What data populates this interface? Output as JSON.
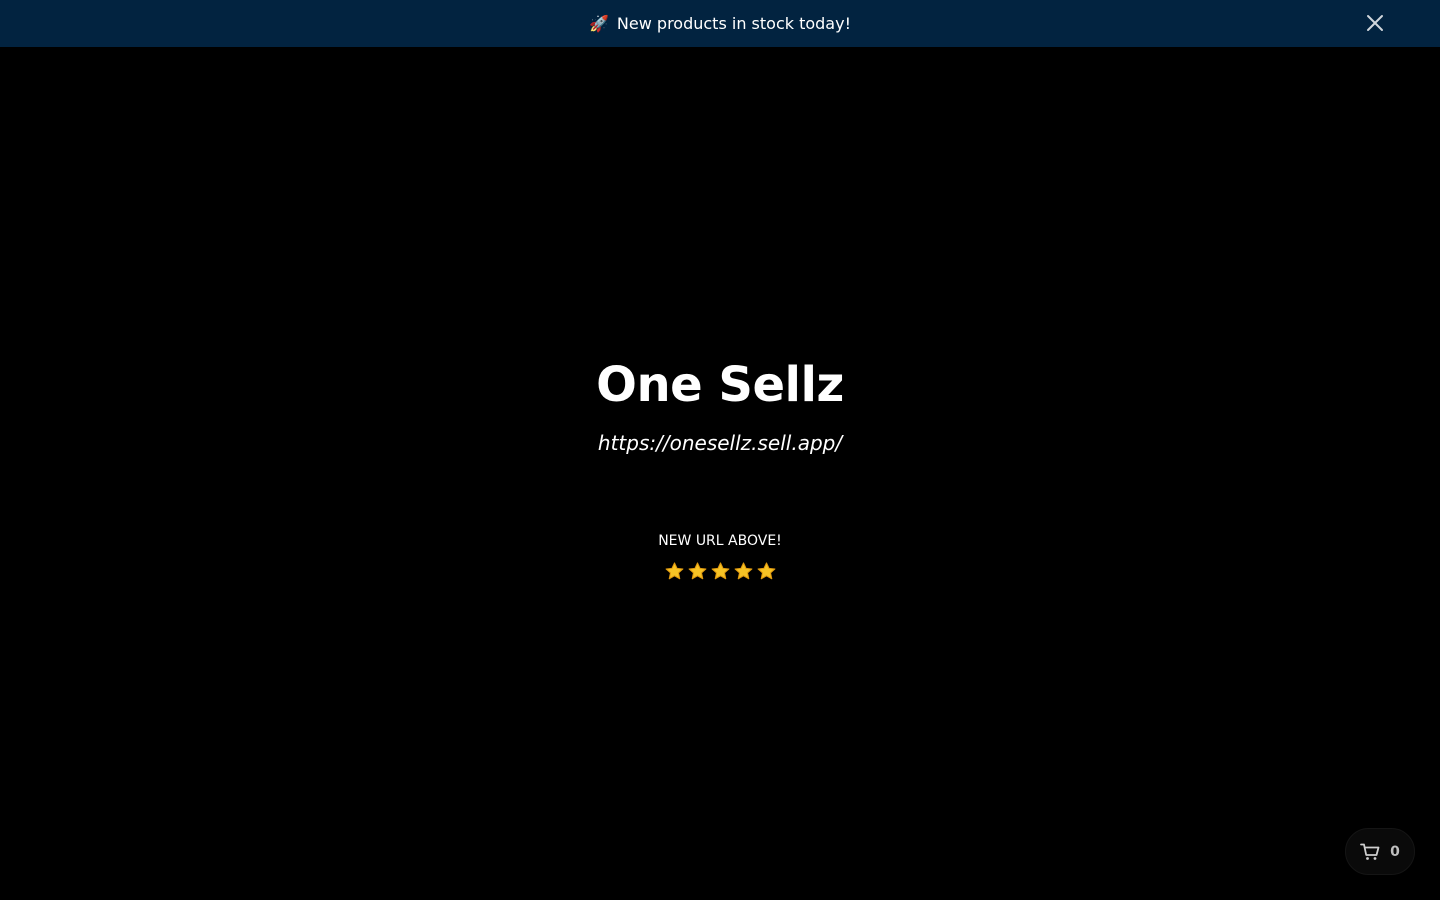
{
  "banner": {
    "icon": "🚀",
    "text": "New products in stock today!",
    "close_icon": "close-icon",
    "background": "#022340"
  },
  "hero": {
    "title": "One Sellz",
    "url": "https://onesellz.sell.app/",
    "notice": "NEW URL ABOVE!",
    "rating": {
      "stars": 5,
      "color": "#F7C325"
    }
  },
  "cart": {
    "icon": "cart-icon",
    "count": "0"
  }
}
